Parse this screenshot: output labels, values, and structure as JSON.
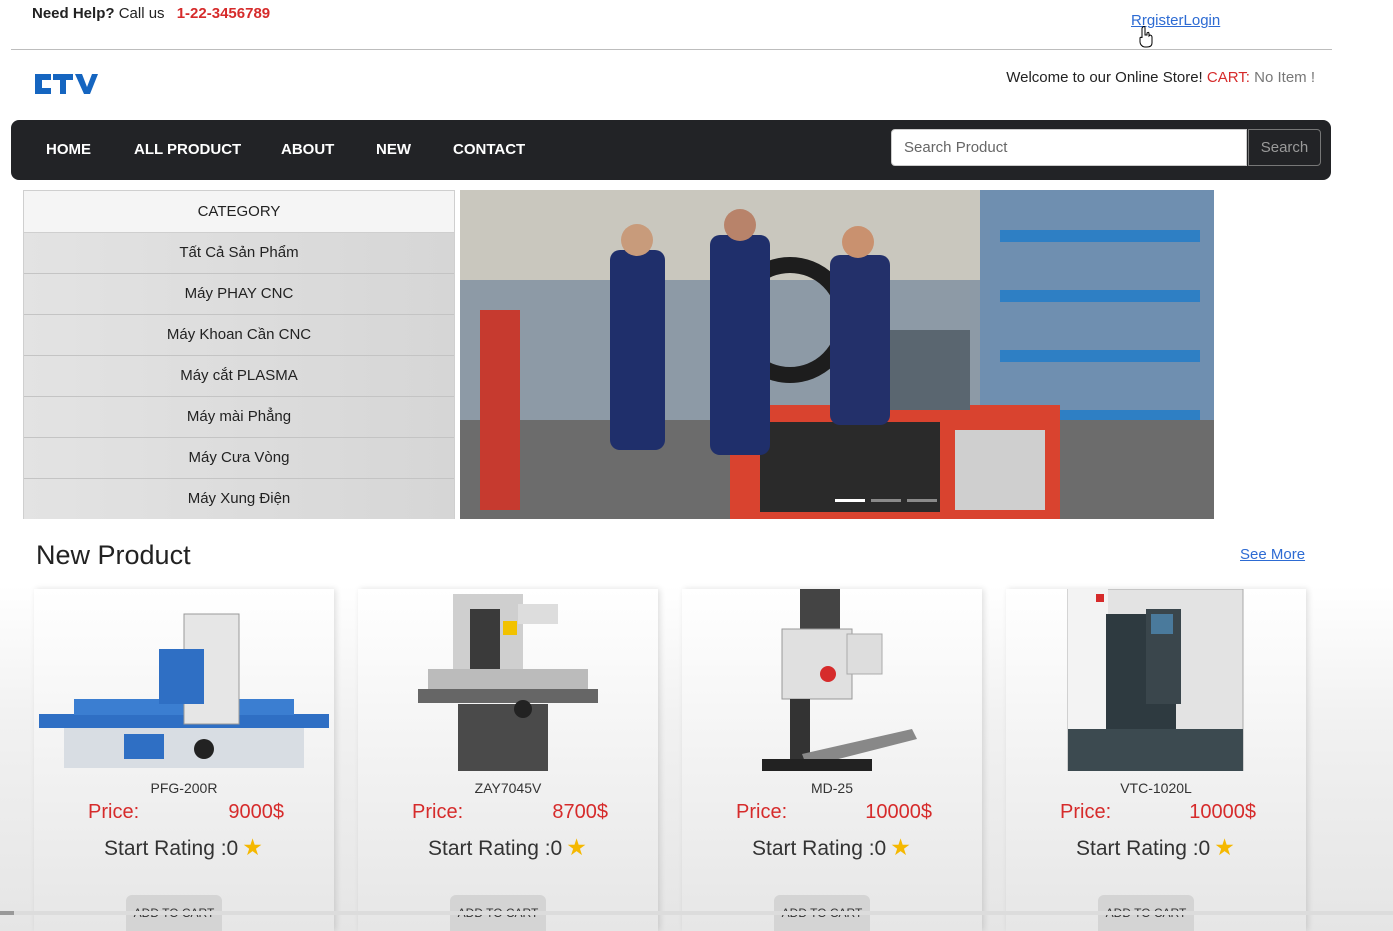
{
  "topbar": {
    "need_help": "Need Help?",
    "call_us": "Call us",
    "phone": "1-22-3456789",
    "auth_link": "RrgisterLogin"
  },
  "header": {
    "welcome": "Welcome to our Online Store!",
    "cart_label": "CART:",
    "cart_status": "No Item !"
  },
  "nav": {
    "items": [
      "HOME",
      "ALL PRODUCT",
      "ABOUT",
      "NEW",
      "CONTACT"
    ],
    "search_placeholder": "Search Product",
    "search_button": "Search"
  },
  "category": {
    "title": "CATEGORY",
    "items": [
      "Tất Cả Sản Phẩm",
      "Máy PHAY CNC",
      "Máy Khoan Cần CNC",
      "Máy cắt PLASMA",
      "Máy mài Phẳng",
      "Máy Cưa Vòng",
      "Máy Xung Điện"
    ]
  },
  "banner": {
    "slides": 3,
    "active_slide": 1
  },
  "new_product": {
    "title": "New Product",
    "see_more": "See More",
    "price_label": "Price:",
    "rating_label": "Start Rating :0",
    "add_to_cart": "ADD TO CART",
    "products": [
      {
        "name": "PFG-200R",
        "price": "9000$"
      },
      {
        "name": "ZAY7045V",
        "price": "8700$"
      },
      {
        "name": "MD-25",
        "price": "10000$"
      },
      {
        "name": "VTC-1020L",
        "price": "10000$"
      }
    ]
  },
  "colors": {
    "accent": "#d62b2b",
    "nav_bg": "#222326",
    "link": "#2d6bd3",
    "logo": "#1565c0",
    "star": "#f5b800"
  },
  "icons": {
    "star": "star-icon",
    "cursor": "hand-cursor-icon",
    "logo": "ctv-logo"
  }
}
